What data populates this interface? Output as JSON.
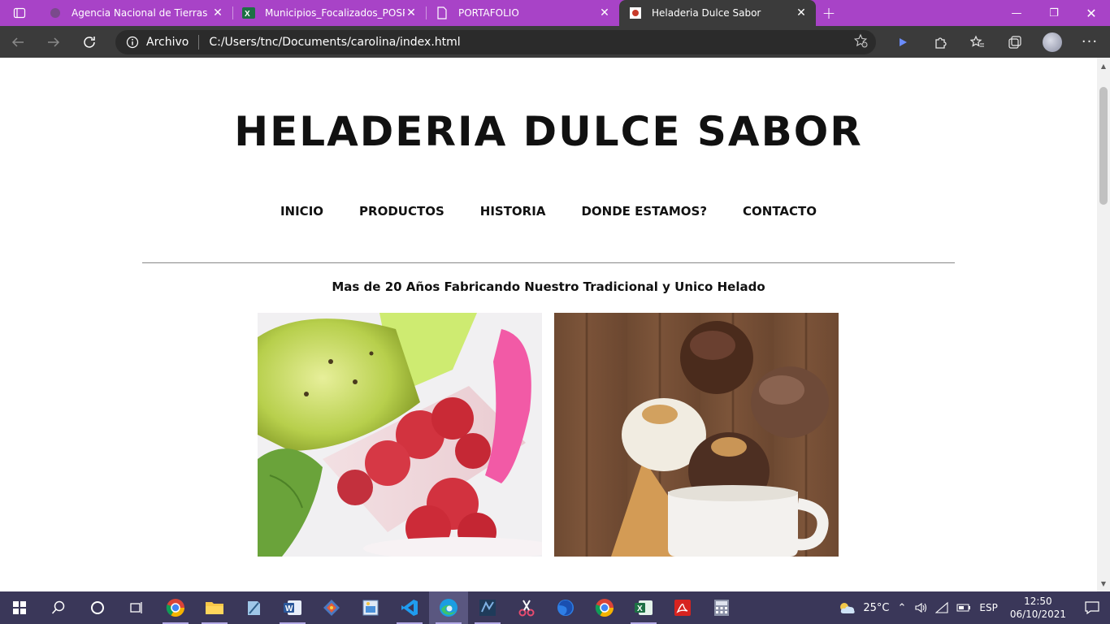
{
  "browser": {
    "tabs": [
      {
        "title": "Agencia Nacional de Tierras",
        "icon": "agency-favicon",
        "active": false
      },
      {
        "title": "Municipios_Focalizados_POSPR.x",
        "icon": "excel-icon",
        "active": false
      },
      {
        "title": "PORTAFOLIO",
        "icon": "document-icon",
        "active": false
      },
      {
        "title": "Heladeria Dulce Sabor",
        "icon": "html-file-icon",
        "active": true
      }
    ],
    "address": {
      "scheme_label": "Archivo",
      "url": "C:/Users/tnc/Documents/carolina/index.html"
    },
    "colors": {
      "tabbar": "#a843c7",
      "toolbar": "#3b3b3b"
    }
  },
  "page": {
    "title": "HELADERIA DULCE SABOR",
    "nav": [
      "INICIO",
      "PRODUCTOS",
      "HISTORIA",
      "DONDE ESTAMOS?",
      "CONTACTO"
    ],
    "tagline": "Mas de 20 Años Fabricando Nuestro Tradicional y Unico Helado",
    "images": [
      "kiwi-raspberry-popsicles-photo",
      "ice-cream-cones-photo"
    ]
  },
  "taskbar": {
    "apps": [
      "chrome-icon",
      "file-explorer-icon",
      "notepad-icon",
      "word-icon",
      "git-icon",
      "paint-icon",
      "vscode-icon",
      "edge-icon",
      "netbeans-icon",
      "scissors-icon",
      "firefox-icon",
      "chrome-icon",
      "excel-icon",
      "acrobat-icon",
      "calculator-icon"
    ],
    "weather": "25°C",
    "language": "ESP",
    "time": "12:50",
    "date": "06/10/2021"
  }
}
